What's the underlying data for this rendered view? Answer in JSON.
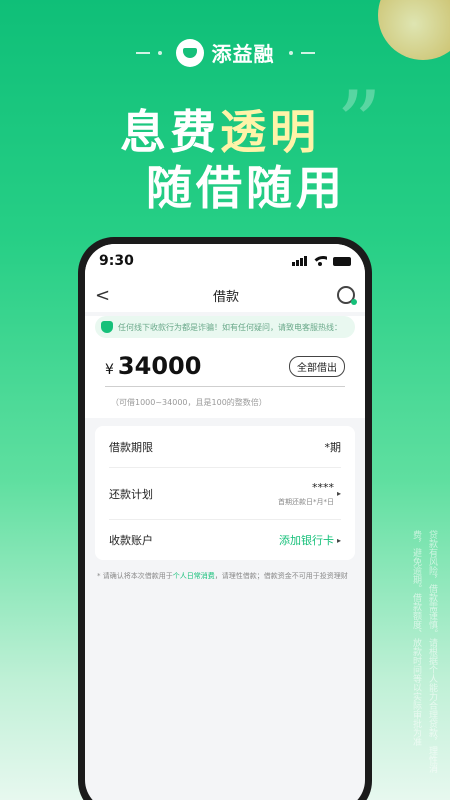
{
  "brand": {
    "name": "添益融"
  },
  "headline": {
    "part1": "息费",
    "highlight": "透明",
    "line2": "随借随用"
  },
  "quote_mark": "”",
  "side_disclaimer": "贷款有风险，借款需谨慎。请根据个人能力合理贷款，理性消费，避免逾期。借款额度、放款时间等以实际审批为准",
  "phone": {
    "status": {
      "time": "9:30"
    },
    "navbar": {
      "back": "<",
      "title": "借款"
    },
    "notice": "任何线下收款行为都是诈骗！如有任何疑问，请致电客服热线：",
    "amount": {
      "currency": "¥",
      "value": "34000",
      "all_button": "全部借出",
      "range": "（可借1000~34000，且是100的整数倍）"
    },
    "rows": [
      {
        "label": "借款期限",
        "value": "*期"
      },
      {
        "label": "还款计划",
        "value": "****",
        "sub": "首期还款日*月*日"
      },
      {
        "label": "收款账户",
        "link": "添加银行卡"
      }
    ],
    "footer": {
      "pre": "* 请确认将本次借款用于",
      "highlight": "个人日常消费",
      "post": "，请理性借款；借款资金不可用于投资理财"
    }
  },
  "colors": {
    "brand_green": "#16c07a",
    "highlight_yellow": "#fff3a8"
  }
}
